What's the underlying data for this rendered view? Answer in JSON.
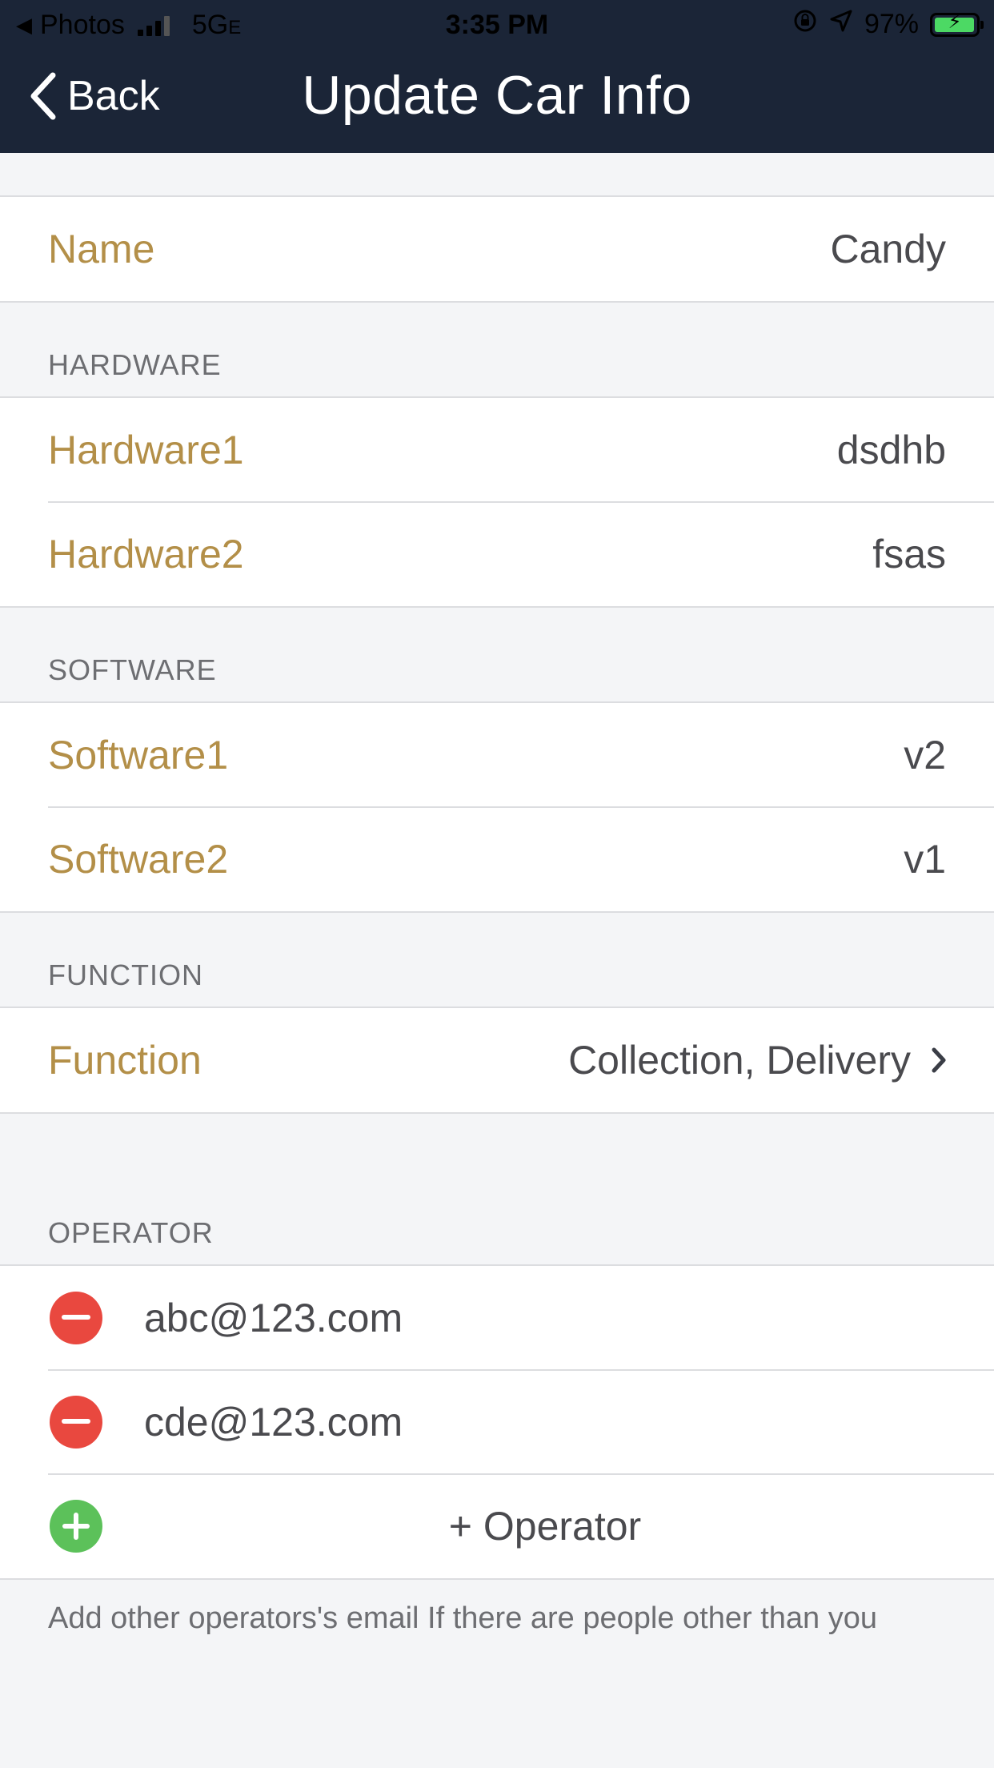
{
  "status_bar": {
    "back_app": "Photos",
    "network": "5G",
    "network_suffix": "E",
    "time": "3:35 PM",
    "battery": "97%",
    "battery_level": 0.97,
    "battery_color": "#4cd964"
  },
  "nav": {
    "back_label": "Back",
    "title": "Update Car Info",
    "bg_color": "#1b2537"
  },
  "name_row": {
    "label": "Name",
    "value": "Candy"
  },
  "hardware": {
    "header": "HARDWARE",
    "rows": [
      {
        "label": "Hardware1",
        "value": "dsdhb"
      },
      {
        "label": "Hardware2",
        "value": "fsas"
      }
    ]
  },
  "software": {
    "header": "SOFTWARE",
    "rows": [
      {
        "label": "Software1",
        "value": "v2"
      },
      {
        "label": "Software2",
        "value": "v1"
      }
    ]
  },
  "function": {
    "header": "FUNCTION",
    "label": "Function",
    "value": "Collection, Delivery"
  },
  "operator": {
    "header": "OPERATOR",
    "emails": [
      "abc@123.com",
      "cde@123.com"
    ],
    "add_label": "+ Operator"
  },
  "footer_note": "Add other operators's email If there are people other than you",
  "colors": {
    "label_gold": "#b38f48",
    "remove_red": "#e9483f",
    "add_green": "#5cc15a"
  }
}
